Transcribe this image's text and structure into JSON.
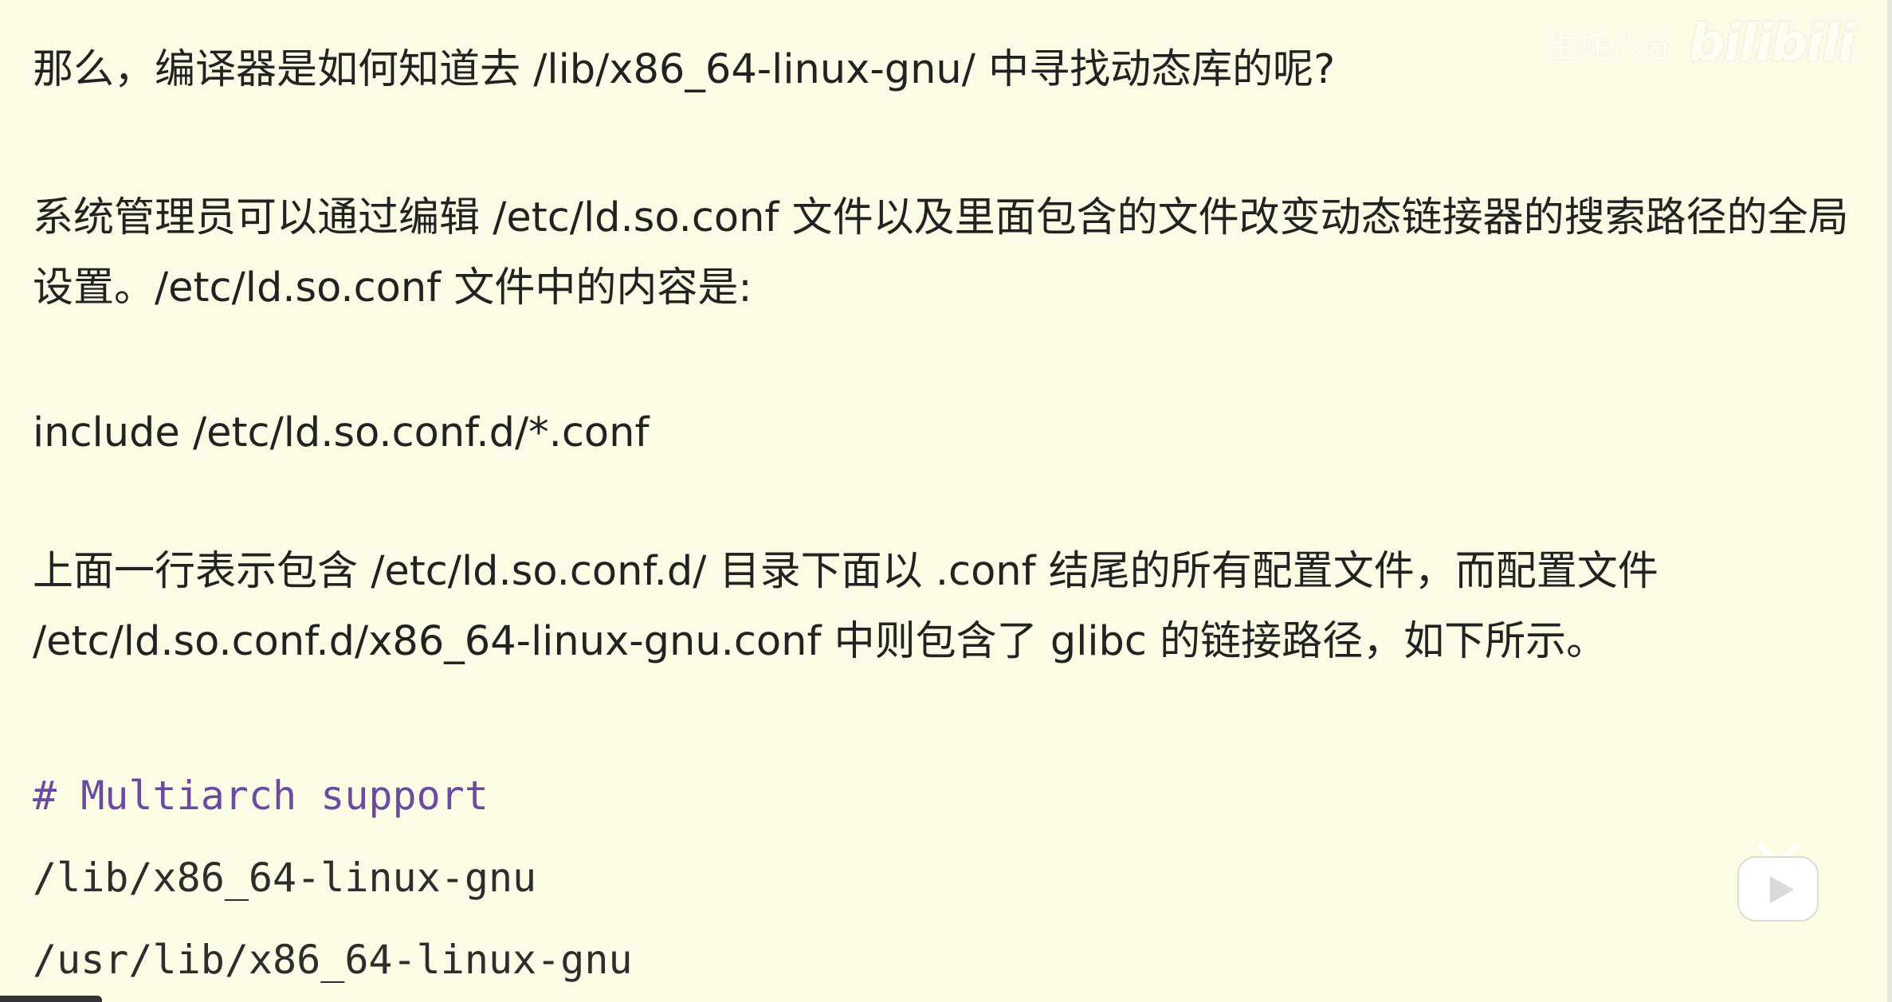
{
  "document": {
    "paragraphs": [
      "那么，编译器是如何知道去 /lib/x86_64-linux-gnu/ 中寻找动态库的呢?",
      "系统管理员可以通过编辑 /etc/ld.so.conf 文件以及里面包含的文件改变动态链接器的搜索路径的全局设置。/etc/ld.so.conf 文件中的内容是:",
      "include /etc/ld.so.conf.d/*.conf",
      "上面一行表示包含 /etc/ld.so.conf.d/ 目录下面以 .conf 结尾的所有配置文件，而配置文件 /etc/ld.so.conf.d/x86_64-linux-gnu.conf 中则包含了 glibc 的链接路径，如下所示。"
    ],
    "code_lines": [
      "# Multiarch support",
      "/lib/x86_64-linux-gnu",
      "/usr/lib/x86_64-linux-gnu"
    ]
  },
  "watermark": {
    "uploader": "生蚝八分",
    "logo": "bilibili"
  },
  "player": {
    "play_icon": "play-icon"
  },
  "colors": {
    "background": "#fbfbe6",
    "text": "#222222",
    "code_comment": "#6b4aa0"
  }
}
